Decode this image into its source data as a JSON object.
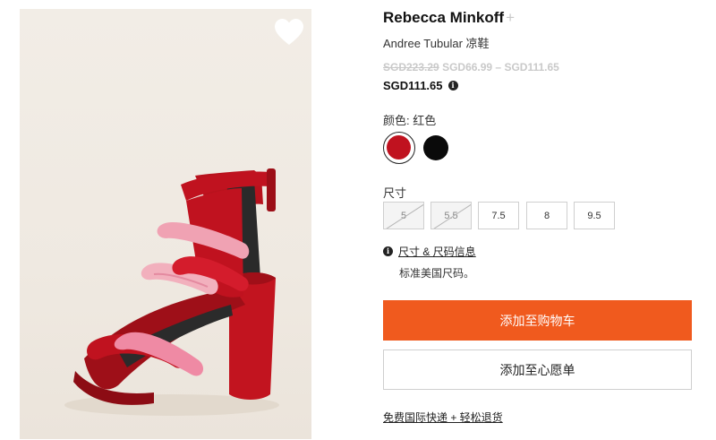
{
  "product": {
    "brand": "Rebecca Minkoff",
    "brand_follow": "+",
    "name": "Andree Tubular 凉鞋",
    "original_price": "SGD223.29",
    "sale_range": "SGD66.99 – SGD111.65",
    "current_price": "SGD111.65",
    "info_glyph": "i"
  },
  "color": {
    "label": "颜色: 红色",
    "swatches": [
      {
        "name": "red",
        "hex": "#c0121f",
        "selected": true
      },
      {
        "name": "black",
        "hex": "#0a0a0a",
        "selected": false
      }
    ]
  },
  "size": {
    "label": "尺寸",
    "options": [
      {
        "value": "5",
        "available": false
      },
      {
        "value": "5.5",
        "available": false
      },
      {
        "value": "7.5",
        "available": true
      },
      {
        "value": "8",
        "available": true
      },
      {
        "value": "9.5",
        "available": true
      }
    ],
    "guide_link": "尺寸 & 尺码信息",
    "note": "标准美国尺码。"
  },
  "actions": {
    "add_to_cart": "添加至购物车",
    "add_to_wishlist": "添加至心愿单",
    "accent_color": "#f05a1e"
  },
  "shipping_link": "免费国际快递 + 轻松退货",
  "icons": {
    "wishlist": "heart-icon",
    "info": "info-icon"
  }
}
